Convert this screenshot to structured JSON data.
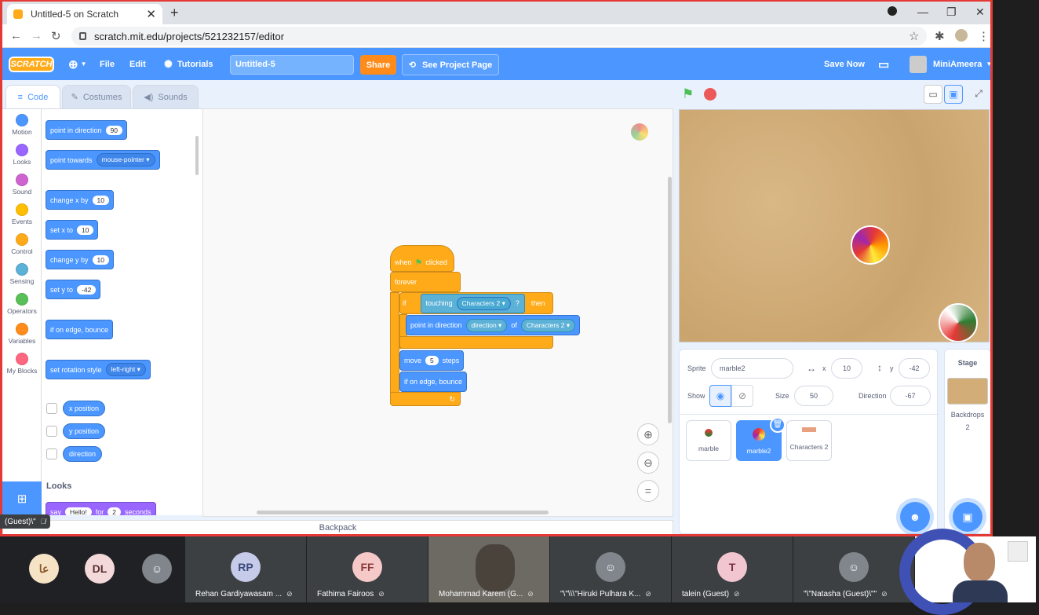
{
  "browser": {
    "tab_title": "Untitled-5 on Scratch",
    "tab_close": "✕",
    "new_tab": "+",
    "url": "scratch.mit.edu/projects/521232157/editor",
    "win_min": "—",
    "win_max": "❐",
    "win_close": "✕"
  },
  "menu": {
    "logo": "SCRATCH",
    "file": "File",
    "edit": "Edit",
    "tutorials": "Tutorials",
    "project_title": "Untitled-5",
    "share": "Share",
    "see_project": "See Project Page",
    "save_now": "Save Now",
    "username": "MiniAmeera"
  },
  "editor_tabs": {
    "code": "Code",
    "costumes": "Costumes",
    "sounds": "Sounds"
  },
  "categories": [
    {
      "label": "Motion",
      "color": "#4c97ff"
    },
    {
      "label": "Looks",
      "color": "#9966ff"
    },
    {
      "label": "Sound",
      "color": "#cf63cf"
    },
    {
      "label": "Events",
      "color": "#ffbf00"
    },
    {
      "label": "Control",
      "color": "#ffab19"
    },
    {
      "label": "Sensing",
      "color": "#5cb1d6"
    },
    {
      "label": "Operators",
      "color": "#59c059"
    },
    {
      "label": "Variables",
      "color": "#ff8c1a"
    },
    {
      "label": "My Blocks",
      "color": "#ff6680"
    }
  ],
  "palette": {
    "point_dir": "point in direction",
    "point_dir_val": "90",
    "point_towards": "point towards",
    "point_towards_val": "mouse-pointer",
    "change_x": "change x by",
    "change_x_val": "10",
    "set_x": "set x to",
    "set_x_val": "10",
    "change_y": "change y by",
    "change_y_val": "10",
    "set_y": "set y to",
    "set_y_val": "-42",
    "bounce": "if on edge, bounce",
    "rot_style": "set rotation style",
    "rot_style_val": "left-right",
    "x_pos": "x position",
    "y_pos": "y position",
    "direction": "direction",
    "looks_heading": "Looks",
    "say": "say",
    "say_val": "Hello!",
    "say_for": "for",
    "say_secs": "2",
    "say_seconds": "seconds"
  },
  "script": {
    "when": "when",
    "clicked": "clicked",
    "forever": "forever",
    "if": "if",
    "touching": "touching",
    "touching_val": "Characters 2",
    "q": "?",
    "then": "then",
    "point_in_dir": "point in direction",
    "dir_sel": "direction",
    "of": "of",
    "of_sel": "Characters 2",
    "move": "move",
    "move_val": "5",
    "steps": "steps",
    "bounce": "if on edge, bounce"
  },
  "backpack": "Backpack",
  "sprite_info": {
    "sprite_label": "Sprite",
    "sprite_name": "marble2",
    "x_label": "x",
    "x_val": "10",
    "y_label": "y",
    "y_val": "-42",
    "show_label": "Show",
    "size_label": "Size",
    "size_val": "50",
    "direction_label": "Direction",
    "direction_val": "-67"
  },
  "sprites": [
    "marble",
    "marble2",
    "Characters 2"
  ],
  "stage_panel": {
    "title": "Stage",
    "backdrops_label": "Backdrops",
    "backdrops_count": "2"
  },
  "meet": {
    "left_tile": "(Guest)\\\"",
    "participants": [
      {
        "initials": "عا",
        "name": ""
      },
      {
        "initials": "DL",
        "name": ""
      },
      {
        "initials": "",
        "name": ""
      },
      {
        "initials": "RP",
        "name": "Rehan Gardiyawasam ..."
      },
      {
        "initials": "FF",
        "name": "Fathima Fairoos"
      },
      {
        "initials": "",
        "name": "Mohammad Karem (G..."
      },
      {
        "initials": "",
        "name": "\"\\\"\\\\\\\"Hiruki Pulhara K..."
      },
      {
        "initials": "T",
        "name": "talein (Guest)"
      },
      {
        "initials": "",
        "name": "\"\\\"Natasha (Guest)\\\"\""
      }
    ]
  },
  "colors": {
    "scratch_blue": "#4c97ff",
    "control_orange": "#ffab19",
    "border_red": "#e53935"
  }
}
